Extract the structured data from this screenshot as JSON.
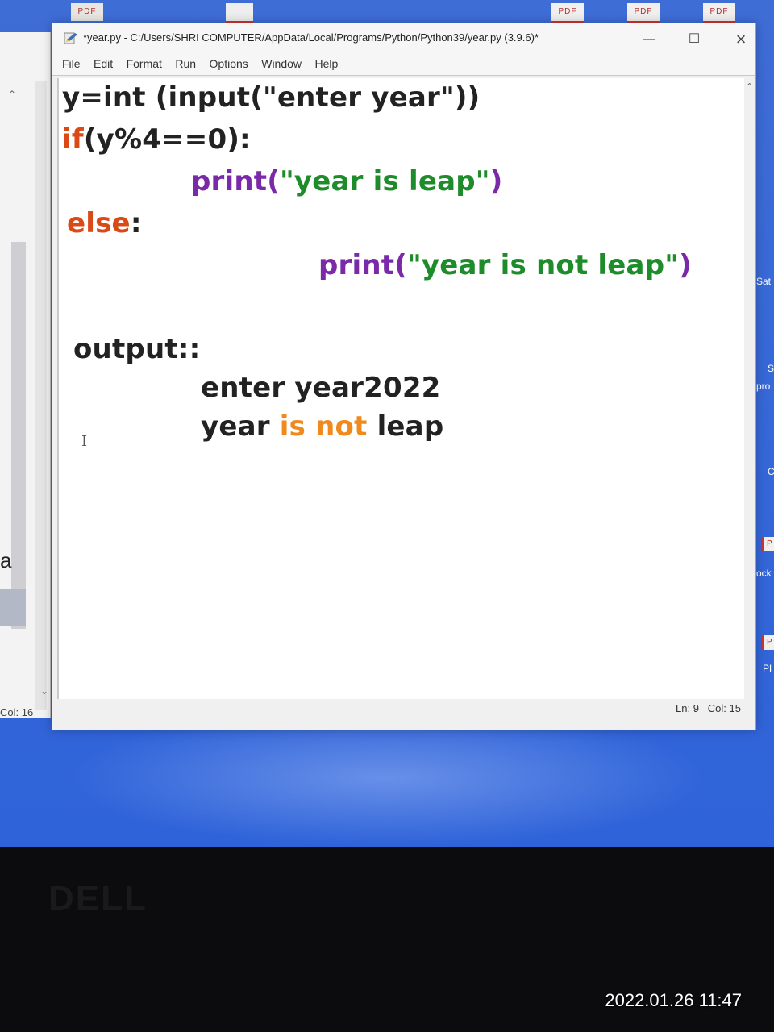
{
  "desktop": {
    "top_icons": [
      "PDF",
      "PDF",
      "PDF",
      "PDF"
    ],
    "right_labels": [
      "Sat",
      "S",
      "pro",
      "C",
      "Mock",
      "PH"
    ],
    "right_badges": [
      "P",
      "P"
    ]
  },
  "background_window": {
    "letter": "a",
    "status_col": "Col: 16"
  },
  "window": {
    "title": "*year.py - C:/Users/SHRI COMPUTER/AppData/Local/Programs/Python/Python39/year.py (3.9.6)*",
    "minimize": "—",
    "maximize": "☐",
    "close": "×",
    "menu": [
      "File",
      "Edit",
      "Format",
      "Run",
      "Options",
      "Window",
      "Help"
    ],
    "status": {
      "line": "Ln: 9",
      "col": "Col: 15"
    }
  },
  "code": {
    "line1": {
      "a": "y=int (input(",
      "b": "\"enter year\"",
      "c": "))"
    },
    "line2": {
      "a": "if",
      "b": "(y%4==0):"
    },
    "line3": {
      "a": "print(",
      "b": "\"year is leap\"",
      "c": ")"
    },
    "line4": {
      "a": "else",
      "b": ":"
    },
    "line5": {
      "a": "print(",
      "b": "\"year is not leap\"",
      "c": ")"
    },
    "line6": {
      "a": "output::"
    },
    "line7": {
      "a": "enter year2022"
    },
    "line8": {
      "a": "year ",
      "b": "is not",
      "c": " leap"
    }
  },
  "monitor": {
    "brand": "DELL"
  },
  "photo": {
    "timestamp": "2022.01.26 11:47"
  },
  "colors": {
    "keyword": "#d94a16",
    "builtin": "#7a2aa8",
    "string": "#1e8c2a",
    "desktop": "#3567d8"
  }
}
